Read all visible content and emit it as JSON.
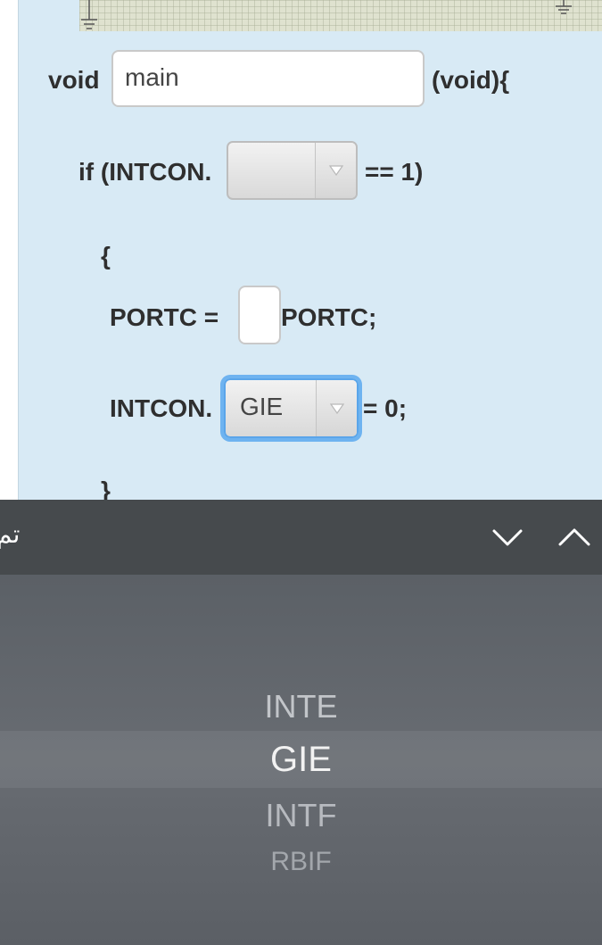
{
  "code": {
    "void_kw": "void",
    "func_name_value": "main",
    "void_params": "(void){",
    "if_prefix": "if (INTCON.",
    "if_select_value": "",
    "if_suffix": "== 1)",
    "open_brace": "{",
    "portc_assign": "PORTC =",
    "operator_value": "",
    "portc_end": "PORTC;",
    "intcon_prefix": "INTCON.",
    "intcon_select_value": "GIE",
    "intcon_suffix": "= 0;",
    "close_brace": "}"
  },
  "picker": {
    "rtl_label": "تم",
    "options": [
      "INTE",
      "GIE",
      "INTF",
      "RBIF"
    ],
    "selected": "GIE"
  },
  "icons": {
    "down": "chevron-down-icon",
    "up": "chevron-up-icon",
    "ground": "ground-symbol-icon"
  },
  "colors": {
    "panel": "#d8eaf5",
    "focus_ring": "#6eb3f0",
    "picker_bar": "#464a4d",
    "picker_wheel": "#62666c"
  }
}
